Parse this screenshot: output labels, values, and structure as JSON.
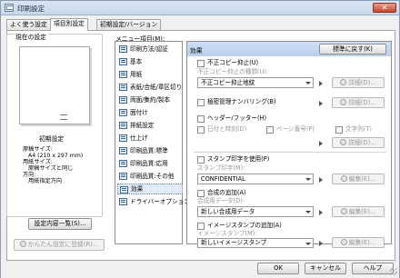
{
  "window": {
    "title": "印刷設定"
  },
  "tabs": [
    {
      "label": "よく使う設定"
    },
    {
      "label": "項目別設定"
    },
    {
      "label": "初期設定/バージョン"
    }
  ],
  "current_settings": {
    "group_title": "現在の設定",
    "name": "初期設定",
    "info_lines": [
      "原稿サイズ:",
      "A4 (210 x 297 mm)",
      "用紙サイズ:",
      "原稿サイズと同じ",
      "方向:",
      "用紙指定方向"
    ],
    "list_button": "設定内容一覧(S)...",
    "register_button": "かんたん設定に登録(R)..."
  },
  "menu": {
    "label": "メニュー項目(M):",
    "items": [
      "印刷方法/認証",
      "基本",
      "用紙",
      "表紙/合紙/章区切り",
      "両面/集約/製本",
      "面付け",
      "排紙設定",
      "仕上げ",
      "印刷品質:標準",
      "印刷品質:応用",
      "印刷品質:その他",
      "効果",
      "ドライバーオプション"
    ],
    "selected": "効果"
  },
  "effects": {
    "header": "効果",
    "reset_button": "標準に戻す(K)",
    "copy_guard": {
      "label": "不正コピー抑止(U)",
      "sub_label": "不正コピー抑止の種類(U):",
      "value": "不正コピー抑止地紋",
      "details": "詳細(D)..."
    },
    "secret_numbering": {
      "label": "極密管理ナンバリング(B)",
      "details": "詳細(D)..."
    },
    "header_footer": {
      "label": "ヘッダー/フッター(H)",
      "date": "日付と時刻(D)",
      "page": "ページ番号(P)",
      "text": "文字列(T)",
      "details": "詳細(D)..."
    },
    "stamp": {
      "label": "スタンプ印字を使用(P)",
      "sub_label": "スタンプ印字(M):",
      "value": "CONFIDENTIAL",
      "edit": "編集(E)..."
    },
    "overlay": {
      "label": "合成の追加(A)",
      "sub_label": "合成用データ(D):",
      "value": "新しい合成用データ",
      "edit": "編集(E)..."
    },
    "image_stamp": {
      "label": "イメージスタンプの追加(A)",
      "sub_label": "イメージスタンプ(M):",
      "value": "新しいイメージスタンプ",
      "edit": "編集(E)..."
    }
  },
  "dialog_buttons": {
    "ok": "OK",
    "cancel": "キャンセル",
    "help": "ヘルプ"
  }
}
